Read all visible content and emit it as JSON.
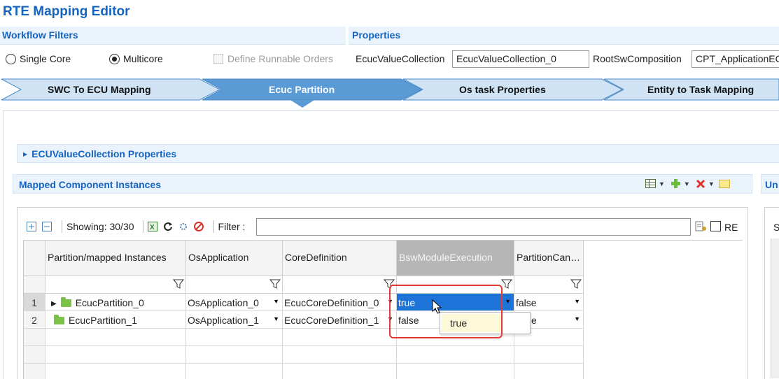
{
  "title": "RTE Mapping Editor",
  "workflow_filters": {
    "heading": "Workflow Filters",
    "options": [
      {
        "label": "Single Core",
        "selected": false
      },
      {
        "label": "Multicore",
        "selected": true
      }
    ],
    "define_runnable_orders": {
      "label": "Define Runnable Orders",
      "checked": false,
      "enabled": false
    }
  },
  "properties": {
    "heading": "Properties",
    "ecuc_value_collection_label": "EcucValueCollection",
    "ecuc_value_collection_value": "EcucValueCollection_0",
    "root_sw_composition_label": "RootSwComposition",
    "root_sw_composition_value": "CPT_ApplicationEC"
  },
  "wizard": {
    "steps": [
      {
        "label": "SWC To ECU Mapping",
        "active": false
      },
      {
        "label": "Ecuc Partition",
        "active": true
      },
      {
        "label": "Os task Properties",
        "active": false
      },
      {
        "label": "Entity to Task Mapping",
        "active": false
      }
    ],
    "colors": {
      "inactive": "#cfe3f5",
      "active": "#5b9bd5",
      "border": "#4a8ac4"
    }
  },
  "ecu_value_collection_section": "ECUValueCollection Properties",
  "mapped_section": {
    "heading": "Mapped Component Instances",
    "right_heading": "Un"
  },
  "toolbar": {
    "showing": "Showing: 30/30",
    "filter_label": "Filter :",
    "filter_value": "",
    "re_label": "RE"
  },
  "table": {
    "columns": [
      "Partition/mapped Instances",
      "OsApplication",
      "CoreDefinition",
      "BswModuleExecution",
      "PartitionCan…"
    ],
    "rows": [
      {
        "num": "1",
        "instance": "EcucPartition_0",
        "expandable": true,
        "os_application": "OsApplication_0",
        "core_definition": "EcucCoreDefinition_0",
        "bsw_module_execution": "true",
        "partition_can": "false"
      },
      {
        "num": "2",
        "instance": "EcucPartition_1",
        "expandable": false,
        "os_application": "OsApplication_1",
        "core_definition": "EcucCoreDefinition_1",
        "bsw_module_execution": "false",
        "partition_can": "e"
      }
    ],
    "dropdown_option": "true"
  },
  "right_panel_letter": "S",
  "accent_color": "#1565c0",
  "selection_color": "#1e73d8",
  "highlight_color": "#e53935"
}
